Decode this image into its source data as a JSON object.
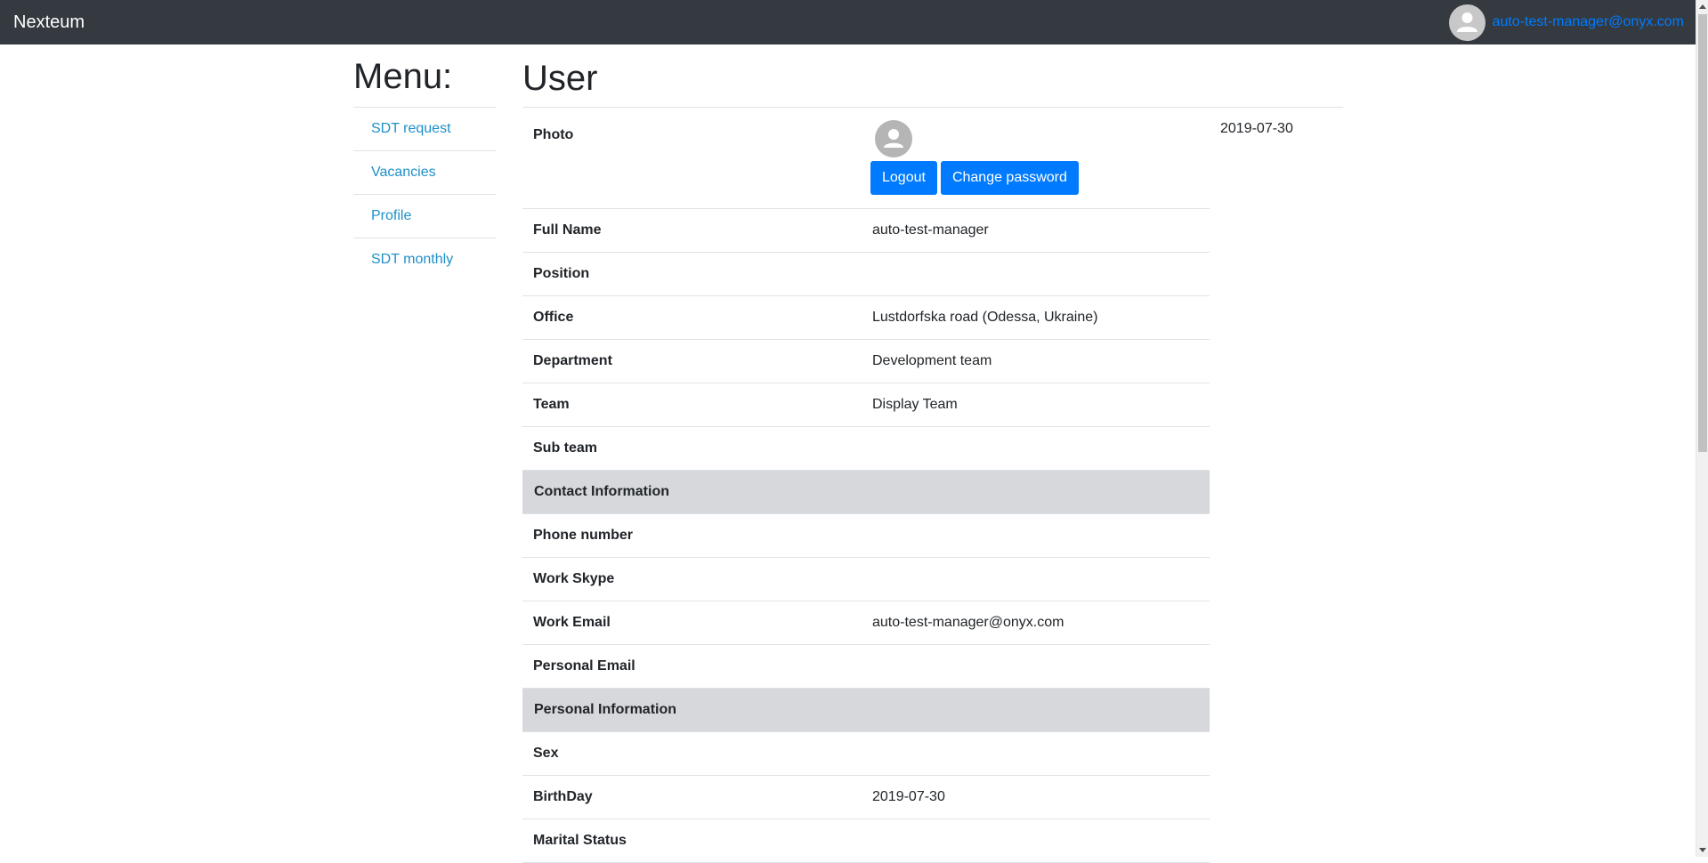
{
  "navbar": {
    "brand": "Nexteum",
    "user_email": "auto-test-manager@onyx.com"
  },
  "menu": {
    "title": "Menu:",
    "items": [
      {
        "label": "SDT request"
      },
      {
        "label": "Vacancies"
      },
      {
        "label": "Profile"
      },
      {
        "label": "SDT monthly"
      }
    ]
  },
  "main": {
    "title": "User",
    "photo_label": "Photo",
    "date": "2019-07-30",
    "buttons": {
      "logout": "Logout",
      "change_password": "Change password"
    },
    "rows": [
      {
        "label": "Full Name",
        "value": "auto-test-manager"
      },
      {
        "label": "Position",
        "value": ""
      },
      {
        "label": "Office",
        "value": "Lustdorfska road (Odessa, Ukraine)"
      },
      {
        "label": "Department",
        "value": "Development team"
      },
      {
        "label": "Team",
        "value": "Display Team"
      },
      {
        "label": "Sub team",
        "value": ""
      }
    ],
    "contact_section": "Contact Information",
    "contact_rows": [
      {
        "label": "Phone number",
        "value": ""
      },
      {
        "label": "Work Skype",
        "value": ""
      },
      {
        "label": "Work Email",
        "value": "auto-test-manager@onyx.com"
      },
      {
        "label": "Personal Email",
        "value": ""
      }
    ],
    "personal_section": "Personal Information",
    "personal_rows": [
      {
        "label": "Sex",
        "value": ""
      },
      {
        "label": "BirthDay",
        "value": "2019-07-30"
      },
      {
        "label": "Marital Status",
        "value": ""
      }
    ]
  },
  "colors": {
    "navbar_bg": "#343a40",
    "link": "#007bff",
    "button_primary": "#007bff",
    "section_bg": "#d6d8db"
  }
}
